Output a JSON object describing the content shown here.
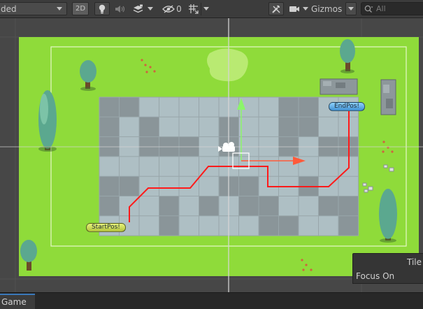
{
  "toolbar": {
    "shading_mode": "ded",
    "mode_2d_label": "2D",
    "hidden_layers_count": "0",
    "gizmos_label": "Gizmos",
    "search_placeholder": "All"
  },
  "scene": {
    "end_label": "EndPos!",
    "start_label": "StartPos!"
  },
  "overlay": {
    "title": "Tile",
    "focus_on_label": "Focus On"
  },
  "tabs": {
    "game_label": "Game"
  },
  "colors": {
    "grass": "#8fdb3a",
    "path_line": "#ff1a1a",
    "axis_x": "#ff5a3a",
    "axis_y": "#8cf56a",
    "tab_accent": "#3a79bb"
  }
}
